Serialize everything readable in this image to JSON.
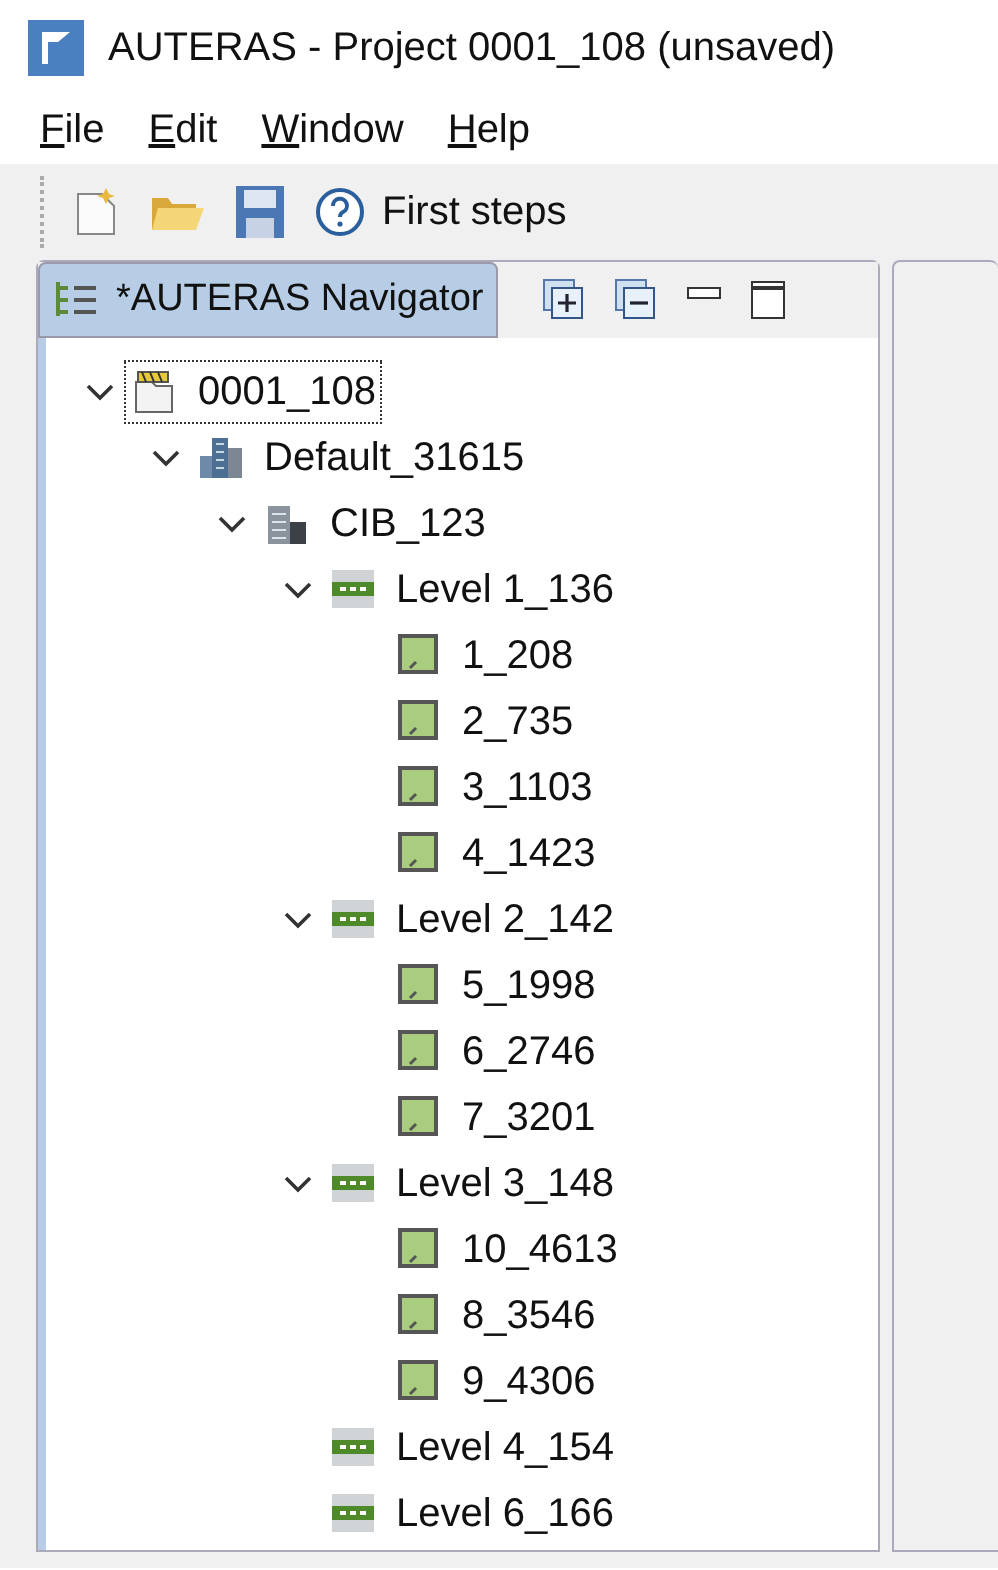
{
  "window": {
    "title": "AUTERAS - Project 0001_108 (unsaved)"
  },
  "menu": [
    "File",
    "Edit",
    "Window",
    "Help"
  ],
  "toolbar": {
    "first_steps": "First steps"
  },
  "navigator": {
    "tab_title": "*AUTERAS Navigator",
    "tree": [
      {
        "kind": "project",
        "label": "0001_108",
        "selected": true,
        "expanded": true,
        "children": [
          {
            "kind": "site",
            "label": "Default_31615",
            "selected": false,
            "expanded": true,
            "children": [
              {
                "kind": "building",
                "label": "CIB_123",
                "selected": false,
                "expanded": true,
                "children": [
                  {
                    "kind": "level",
                    "label": "Level 1_136",
                    "selected": false,
                    "expanded": true,
                    "children": [
                      {
                        "kind": "room",
                        "label": "1_208",
                        "selected": false
                      },
                      {
                        "kind": "room",
                        "label": "2_735",
                        "selected": false
                      },
                      {
                        "kind": "room",
                        "label": "3_1103",
                        "selected": false
                      },
                      {
                        "kind": "room",
                        "label": "4_1423",
                        "selected": false
                      }
                    ]
                  },
                  {
                    "kind": "level",
                    "label": "Level 2_142",
                    "selected": false,
                    "expanded": true,
                    "children": [
                      {
                        "kind": "room",
                        "label": "5_1998",
                        "selected": false
                      },
                      {
                        "kind": "room",
                        "label": "6_2746",
                        "selected": false
                      },
                      {
                        "kind": "room",
                        "label": "7_3201",
                        "selected": false
                      }
                    ]
                  },
                  {
                    "kind": "level",
                    "label": "Level 3_148",
                    "selected": false,
                    "expanded": true,
                    "children": [
                      {
                        "kind": "room",
                        "label": "10_4613",
                        "selected": false
                      },
                      {
                        "kind": "room",
                        "label": "8_3546",
                        "selected": false
                      },
                      {
                        "kind": "room",
                        "label": "9_4306",
                        "selected": false
                      }
                    ]
                  },
                  {
                    "kind": "level",
                    "label": "Level 4_154",
                    "selected": false
                  },
                  {
                    "kind": "level",
                    "label": "Level 6_166",
                    "selected": false
                  }
                ]
              }
            ]
          }
        ]
      }
    ]
  }
}
